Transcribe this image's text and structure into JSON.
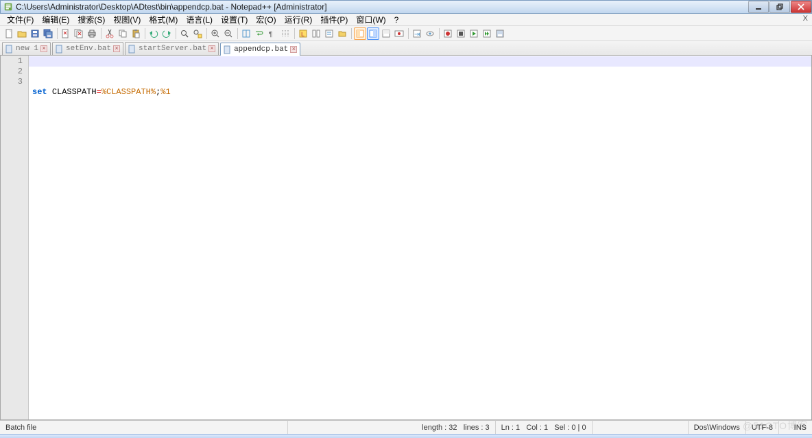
{
  "window": {
    "title": "C:\\Users\\Administrator\\Desktop\\ADtest\\bin\\appendcp.bat - Notepad++ [Administrator]"
  },
  "menu": {
    "items": [
      "文件(F)",
      "编辑(E)",
      "搜索(S)",
      "视图(V)",
      "格式(M)",
      "语言(L)",
      "设置(T)",
      "宏(O)",
      "运行(R)",
      "插件(P)",
      "窗口(W)",
      "?"
    ],
    "close": "X"
  },
  "tabs": [
    {
      "label": "new 1",
      "active": false
    },
    {
      "label": "setEnv.bat",
      "active": false
    },
    {
      "label": "startServer.bat",
      "active": false
    },
    {
      "label": "appendcp.bat",
      "active": true
    }
  ],
  "editor": {
    "gutter": [
      "1",
      "2",
      "3"
    ],
    "tokens": {
      "kw_set": "set",
      "sp1": " ",
      "t_class": "CLASSPATH",
      "op_eq": "=",
      "var_cp": "%CLASSPATH%",
      "semi": ";",
      "var_1": "%1"
    }
  },
  "statusbar": {
    "filetype": "Batch file",
    "length": "length : 32",
    "lines": "lines : 3",
    "ln": "Ln : 1",
    "col": "Col : 1",
    "sel": "Sel : 0 | 0",
    "eol": "Dos\\Windows",
    "encoding": "UTF-8",
    "mode": "INS"
  },
  "icons": {
    "app": "notepadpp-icon"
  },
  "watermark": "@51CTO博客"
}
